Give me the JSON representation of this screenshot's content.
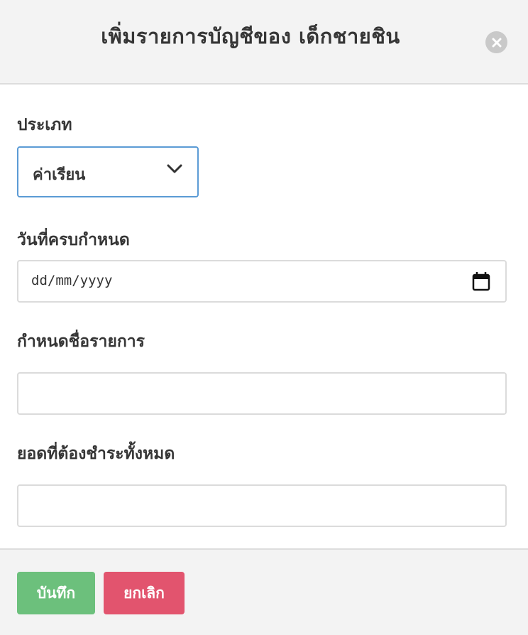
{
  "header": {
    "title": "เพิ่มรายการบัญชีของ เด็กชายชิน"
  },
  "form": {
    "type": {
      "label": "ประเภท",
      "selected": "ค่าเรียน"
    },
    "due_date": {
      "label": "วันที่ครบกำหนด",
      "placeholder": "dd/mm/yyyy"
    },
    "item_name": {
      "label": "กำหนดชื่อรายการ",
      "value": ""
    },
    "total_amount": {
      "label": "ยอดที่ต้องชำระทั้งหมด",
      "value": ""
    }
  },
  "footer": {
    "save_label": "บันทึก",
    "cancel_label": "ยกเลิก"
  },
  "colors": {
    "save": "#6cc07c",
    "cancel": "#e2546e",
    "focus_border": "#5b9bd5",
    "header_bg": "#f3f3f3"
  },
  "icons": {
    "close": "close-icon",
    "chevron": "chevron-down-icon",
    "calendar": "calendar-icon"
  }
}
